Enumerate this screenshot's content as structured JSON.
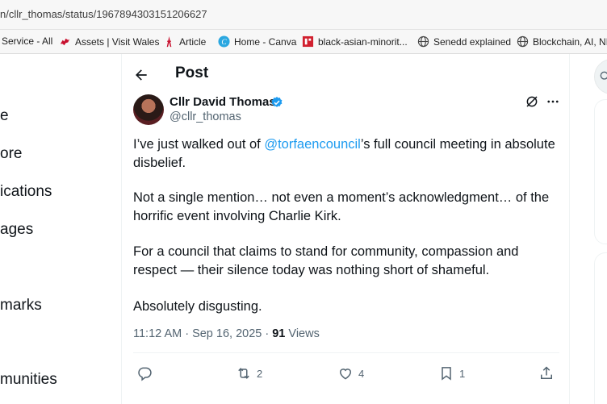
{
  "browser": {
    "url": "n/cllr_thomas/status/1967894303151206627",
    "bookmarks": [
      {
        "label": "Service - All",
        "icon": "none"
      },
      {
        "label": "Assets | Visit Wales",
        "icon": "welsh-dragon-icon"
      },
      {
        "label": "Article",
        "icon": "tower-icon"
      },
      {
        "label": "Home - Canva",
        "icon": "canva-icon"
      },
      {
        "label": "black-asian-minorit...",
        "icon": "red-logo-icon"
      },
      {
        "label": "Senedd explained",
        "icon": "globe-icon"
      },
      {
        "label": "Blockchain, AI, NFT",
        "icon": "globe-icon"
      }
    ]
  },
  "nav": {
    "items": [
      "e",
      "ore",
      "ications",
      "ages",
      "marks",
      "munities"
    ]
  },
  "post": {
    "header_title": "Post",
    "author_name": "Cllr David Thomas",
    "handle": "@cllr_thomas",
    "paragraphs": {
      "p1_before": "I’ve just walked out of ",
      "p1_mention": "@torfaencouncil",
      "p1_after": "’s full council meeting in absolute disbelief.",
      "p2": "Not a single mention… not even a moment’s acknowledgment… of the horrific event involving Charlie Kirk.",
      "p3": "For a council that claims to stand for community, compassion and respect — their silence today was nothing short of shameful.",
      "p4": "Absolutely disgusting."
    },
    "meta": {
      "time": "11:12 AM · Sep 16, 2025 · ",
      "views_count": "91",
      "views_label": " Views"
    },
    "actions": {
      "replies": "",
      "reposts": "2",
      "likes": "4",
      "bookmarks": "1"
    }
  },
  "colors": {
    "accent": "#1d9bf0",
    "text": "#0f1419",
    "secondary": "#536471",
    "verified": "#1d9bf0"
  }
}
